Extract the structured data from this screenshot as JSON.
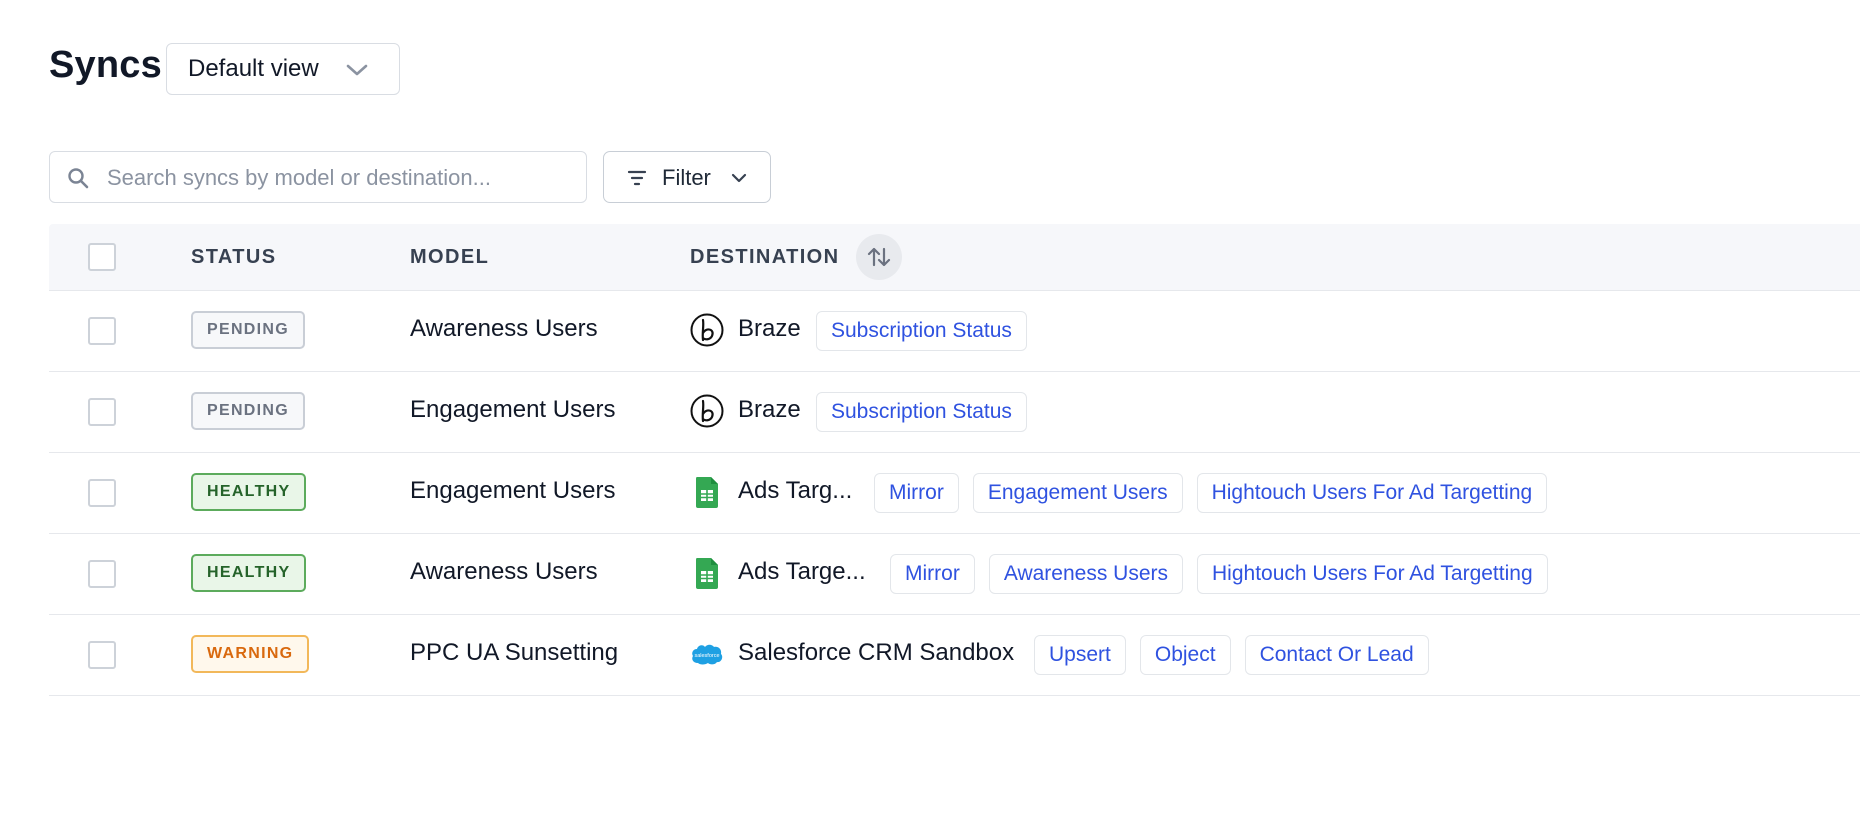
{
  "header": {
    "title": "Syncs",
    "view_select": {
      "value": "Default view"
    }
  },
  "toolbar": {
    "search": {
      "placeholder": "Search syncs by model or destination..."
    },
    "filter_label": "Filter"
  },
  "table": {
    "columns": {
      "status": "STATUS",
      "model": "MODEL",
      "destination": "DESTINATION"
    },
    "rows": [
      {
        "status": "PENDING",
        "model": "Awareness Users",
        "destination": "Braze",
        "dest_icon": "braze-icon",
        "tags": [
          "Subscription Status"
        ]
      },
      {
        "status": "PENDING",
        "model": "Engagement Users",
        "destination": "Braze",
        "dest_icon": "braze-icon",
        "tags": [
          "Subscription Status"
        ]
      },
      {
        "status": "HEALTHY",
        "model": "Engagement Users",
        "destination": "Ads Targ...",
        "dest_icon": "google-sheets-icon",
        "tags": [
          "Mirror",
          "Engagement Users",
          "Hightouch Users For Ad Targetting"
        ]
      },
      {
        "status": "HEALTHY",
        "model": "Awareness Users",
        "destination": "Ads Targe...",
        "dest_icon": "google-sheets-icon",
        "tags": [
          "Mirror",
          "Awareness Users",
          "Hightouch Users For Ad Targetting"
        ]
      },
      {
        "status": "WARNING",
        "model": "PPC UA Sunsetting",
        "destination": "Salesforce CRM Sandbox",
        "dest_icon": "salesforce-icon",
        "tags": [
          "Upsert",
          "Object",
          "Contact Or Lead"
        ]
      }
    ]
  },
  "colors": {
    "tag_text": "#2f52e0",
    "healthy": "#25632a",
    "warning": "#d9690e",
    "pending": "#6b7280",
    "sheets_green": "#34a853",
    "salesforce_blue": "#1ea0e3"
  }
}
